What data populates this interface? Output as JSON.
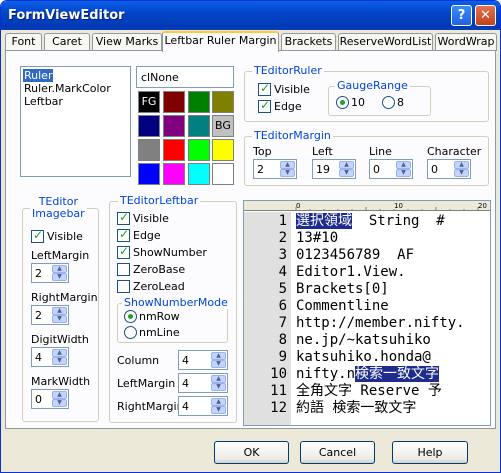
{
  "window": {
    "title": "FormViewEditor"
  },
  "tabs": [
    {
      "label": "Font"
    },
    {
      "label": "Caret"
    },
    {
      "label": "View Marks"
    },
    {
      "label": "Leftbar Ruler Margin"
    },
    {
      "label": "Brackets"
    },
    {
      "label": "ReserveWordList"
    },
    {
      "label": "WordWrap"
    }
  ],
  "color_list": {
    "items": [
      "Ruler",
      "Ruler.MarkColor",
      "Leftbar"
    ],
    "selected": "Ruler"
  },
  "color_name": "clNone",
  "palette": {
    "fg_label": "FG",
    "bg_label": "BG",
    "colors": [
      "#000000",
      "#800000",
      "#008000",
      "#808000",
      "#000080",
      "#800080",
      "#008080",
      "#c0c0c0",
      "#808080",
      "#ff0000",
      "#00ff00",
      "#ffff00",
      "#0000ff",
      "#ff00ff",
      "#00ffff",
      "#ffffff"
    ]
  },
  "editor_ruler": {
    "title": "TEditorRuler",
    "visible_label": "Visible",
    "visible": true,
    "edge_label": "Edge",
    "edge": true,
    "gauge_title": "GaugeRange",
    "gauge_options": [
      "10",
      "8"
    ],
    "gauge_selected": "10"
  },
  "editor_margin": {
    "title": "TEditorMargin",
    "fields": [
      {
        "label": "Top",
        "value": "2"
      },
      {
        "label": "Left",
        "value": "19"
      },
      {
        "label": "Line",
        "value": "0"
      },
      {
        "label": "Character",
        "value": "0"
      }
    ]
  },
  "imagebar": {
    "title_line1": "TEditor",
    "title_line2": "Imagebar",
    "visible_label": "Visible",
    "visible": true,
    "left_margin_label": "LeftMargin",
    "left_margin": "2",
    "right_margin_label": "RightMargin",
    "right_margin": "2",
    "digit_width_label": "DigitWidth",
    "digit_width": "4",
    "mark_width_label": "MarkWidth",
    "mark_width": "0"
  },
  "leftbar": {
    "title": "TEditorLeftbar",
    "visible_label": "Visible",
    "visible": true,
    "edge_label": "Edge",
    "edge": true,
    "show_number_label": "ShowNumber",
    "show_number": true,
    "zero_base_label": "ZeroBase",
    "zero_base": false,
    "zero_lead_label": "ZeroLead",
    "zero_lead": false,
    "mode_title": "ShowNumberMode",
    "mode_options": [
      "nmRow",
      "nmLine"
    ],
    "mode_selected": "nmRow",
    "column_label": "Column",
    "column": "4",
    "left_margin_label": "LeftMargin",
    "left_margin": "4",
    "right_margin_label": "RightMargin",
    "right_margin": "4"
  },
  "preview": {
    "ruler_ticks": [
      "0",
      "10",
      "20"
    ],
    "lines": [
      {
        "num": "1",
        "pre": "",
        "hl": "選択領域",
        "post": "  String  #"
      },
      {
        "num": "2",
        "pre": "13#10",
        "hl": "",
        "post": ""
      },
      {
        "num": "3",
        "pre": "0123456789  AF",
        "hl": "",
        "post": ""
      },
      {
        "num": "4",
        "pre": "Editor1.View.",
        "hl": "",
        "post": ""
      },
      {
        "num": "5",
        "pre": "Brackets[0]",
        "hl": "",
        "post": ""
      },
      {
        "num": "6",
        "pre": "Commentline",
        "hl": "",
        "post": ""
      },
      {
        "num": "7",
        "pre": "http://member.nifty.",
        "hl": "",
        "post": ""
      },
      {
        "num": "8",
        "pre": "ne.jp/~katsuhiko",
        "hl": "",
        "post": ""
      },
      {
        "num": "9",
        "pre": "katsuhiko.honda@",
        "hl": "",
        "post": ""
      },
      {
        "num": "10",
        "pre": "nifty.n",
        "hl": "検索一致文字",
        "post": ""
      },
      {
        "num": "11",
        "pre": "全角文字 Reserve 予",
        "hl": "",
        "post": ""
      },
      {
        "num": "12",
        "pre": "約語 検索一致文字",
        "hl": "",
        "post": ""
      }
    ]
  },
  "buttons": {
    "ok": "OK",
    "cancel": "Cancel",
    "help": "Help"
  }
}
